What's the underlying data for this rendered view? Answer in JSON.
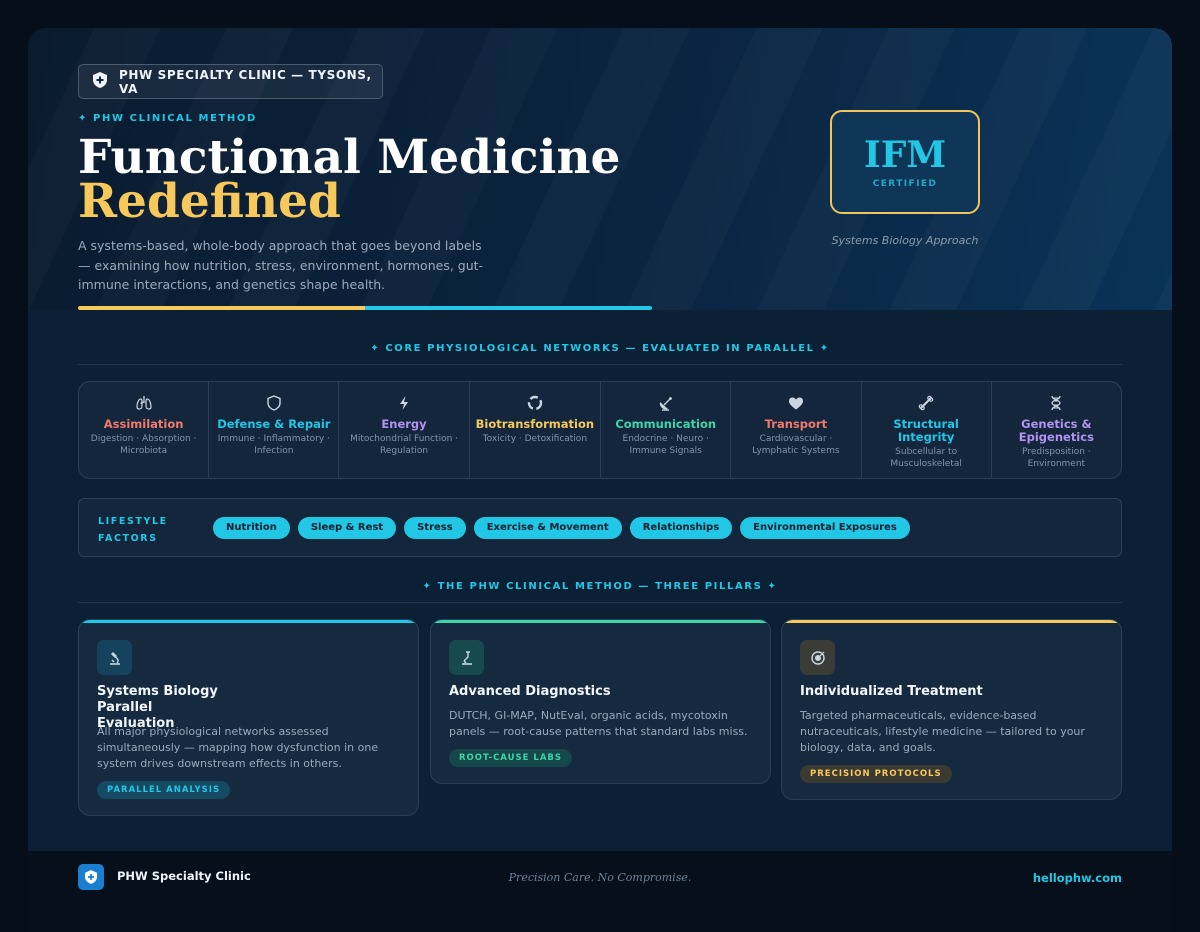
{
  "hero": {
    "clinic_label": "PHW SPECIALTY CLINIC — TYSONS, VA",
    "kicker": "✦ PHW CLINICAL METHOD",
    "title_line1": "Functional Medicine",
    "title_line2": "Redefined",
    "description": "A systems-based, whole-body approach that goes beyond labels — examining how nutrition, stress, environment, hormones, gut-immune interactions, and genetics shape health.",
    "badge_main": "IFM",
    "badge_sub": "CERTIFIED",
    "badge_caption": "Systems Biology Approach"
  },
  "networks_section": {
    "heading": "✦   CORE PHYSIOLOGICAL NETWORKS — EVALUATED IN PARALLEL   ✦",
    "items": [
      {
        "name": "Assimilation",
        "sub": "Digestion · Absorption · Microbiota",
        "color": "#f07a6c",
        "icon": "lungs-icon"
      },
      {
        "name": "Defense & Repair",
        "sub": "Immune · Inflammatory · Infection",
        "color": "#22c7e6",
        "icon": "shield-icon"
      },
      {
        "name": "Energy",
        "sub": "Mitochondrial Function · Regulation",
        "color": "#b392f0",
        "icon": "lightning-icon"
      },
      {
        "name": "Biotransformation",
        "sub": "Toxicity · Detoxification",
        "color": "#f7c85a",
        "icon": "recycle-icon"
      },
      {
        "name": "Communication",
        "sub": "Endocrine · Neuro · Immune Signals",
        "color": "#3ed6a8",
        "icon": "satellite-dish-icon"
      },
      {
        "name": "Transport",
        "sub": "Cardiovascular · Lymphatic Systems",
        "color": "#f07a6c",
        "icon": "heart-icon"
      },
      {
        "name": "Structural Integrity",
        "sub": "Subcellular to Musculoskeletal",
        "color": "#22c7e6",
        "icon": "bone-icon"
      },
      {
        "name": "Genetics & Epigenetics",
        "sub": "Predisposition · Environment",
        "color": "#b392f0",
        "icon": "dna-icon"
      }
    ]
  },
  "lifestyle": {
    "label": "LIFESTYLE FACTORS",
    "chips": [
      "Nutrition",
      "Sleep & Rest",
      "Stress",
      "Exercise & Movement",
      "Relationships",
      "Environmental Exposures"
    ]
  },
  "pillars_section": {
    "heading": "✦   THE PHW CLINICAL METHOD — THREE PILLARS   ✦",
    "pillars": [
      {
        "title": "Systems Biology Parallel Evaluation",
        "description": "All major physiological networks assessed simultaneously — mapping how dysfunction in one system drives downstream effects in others.",
        "tag": "PARALLEL ANALYSIS",
        "accent": "#22c7e6",
        "icon": "microscope-icon"
      },
      {
        "title": "Advanced Diagnostics",
        "description": "DUTCH, GI-MAP, NutEval, organic acids, mycotoxin panels — root-cause patterns that standard labs miss.",
        "tag": "ROOT-CAUSE LABS",
        "accent": "#3ed6a8",
        "icon": "lab-icon"
      },
      {
        "title": "Individualized Treatment",
        "description": "Targeted pharmaceuticals, evidence-based nutraceuticals, lifestyle medicine — tailored to your biology, data, and goals.",
        "tag": "PRECISION PROTOCOLS",
        "accent": "#f7c85a",
        "icon": "target-icon"
      }
    ]
  },
  "footer": {
    "name": "PHW Specialty Clinic",
    "tagline": "Precision Care. No Compromise.",
    "url": "hellophw.com"
  }
}
